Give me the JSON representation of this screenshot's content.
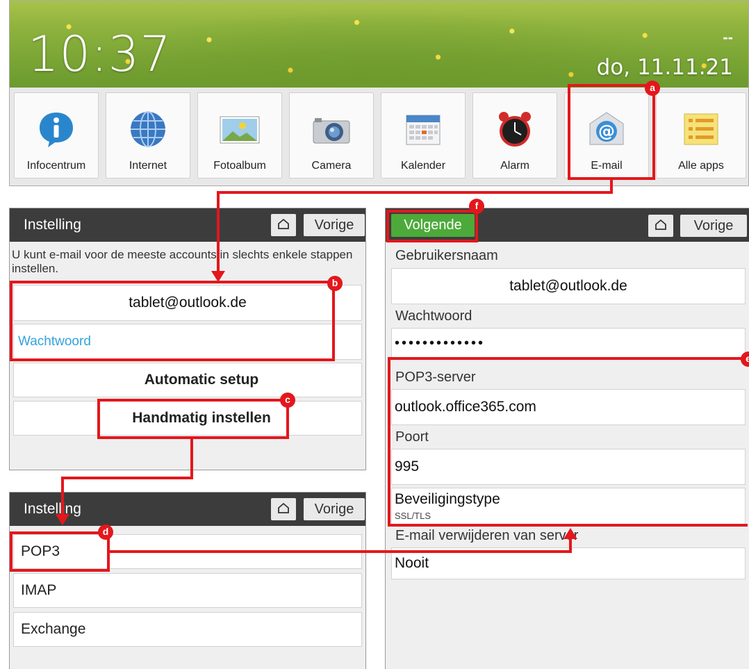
{
  "home": {
    "time": "10:37",
    "date": "do, 11.11.21",
    "status": "--",
    "apps": [
      {
        "label": "Infocentrum",
        "icon": "info-icon"
      },
      {
        "label": "Internet",
        "icon": "globe-icon"
      },
      {
        "label": "Fotoalbum",
        "icon": "photo-icon"
      },
      {
        "label": "Camera",
        "icon": "camera-icon"
      },
      {
        "label": "Kalender",
        "icon": "calendar-icon"
      },
      {
        "label": "Alarm",
        "icon": "alarm-clock-icon"
      },
      {
        "label": "E-mail",
        "icon": "email-at-icon"
      },
      {
        "label": "Alle apps",
        "icon": "list-icon"
      }
    ]
  },
  "setup1": {
    "title": "Instelling",
    "back_label": "Vorige",
    "intro": "U kunt e-mail voor de meeste accounts in slechts enkele stappen instellen.",
    "email_value": "tablet@outlook.de",
    "password_placeholder": "Wachtwoord",
    "automatic_label": "Automatic setup",
    "manual_label": "Handmatig instellen"
  },
  "setup2": {
    "title": "Instelling",
    "back_label": "Vorige",
    "account_types": [
      "POP3",
      "IMAP",
      "Exchange"
    ]
  },
  "incoming": {
    "next_label": "Volgende",
    "back_label": "Vorige",
    "username_label": "Gebruikersnaam",
    "username_value": "tablet@outlook.de",
    "password_label": "Wachtwoord",
    "password_value": "•••••••••••••",
    "server_label": "POP3-server",
    "server_value": "outlook.office365.com",
    "port_label": "Poort",
    "port_value": "995",
    "security_label": "Beveiligingstype",
    "security_value": "SSL/TLS",
    "delete_label": "E-mail verwijderen van server",
    "delete_value": "Nooit"
  },
  "annotations": {
    "a": "a",
    "b": "b",
    "c": "c",
    "d": "d",
    "e": "e",
    "f": "f"
  },
  "colors": {
    "annotation_red": "#e3171c",
    "next_green": "#4caa3a",
    "link_blue": "#33a3dc",
    "titlebar": "#3c3c3c"
  }
}
